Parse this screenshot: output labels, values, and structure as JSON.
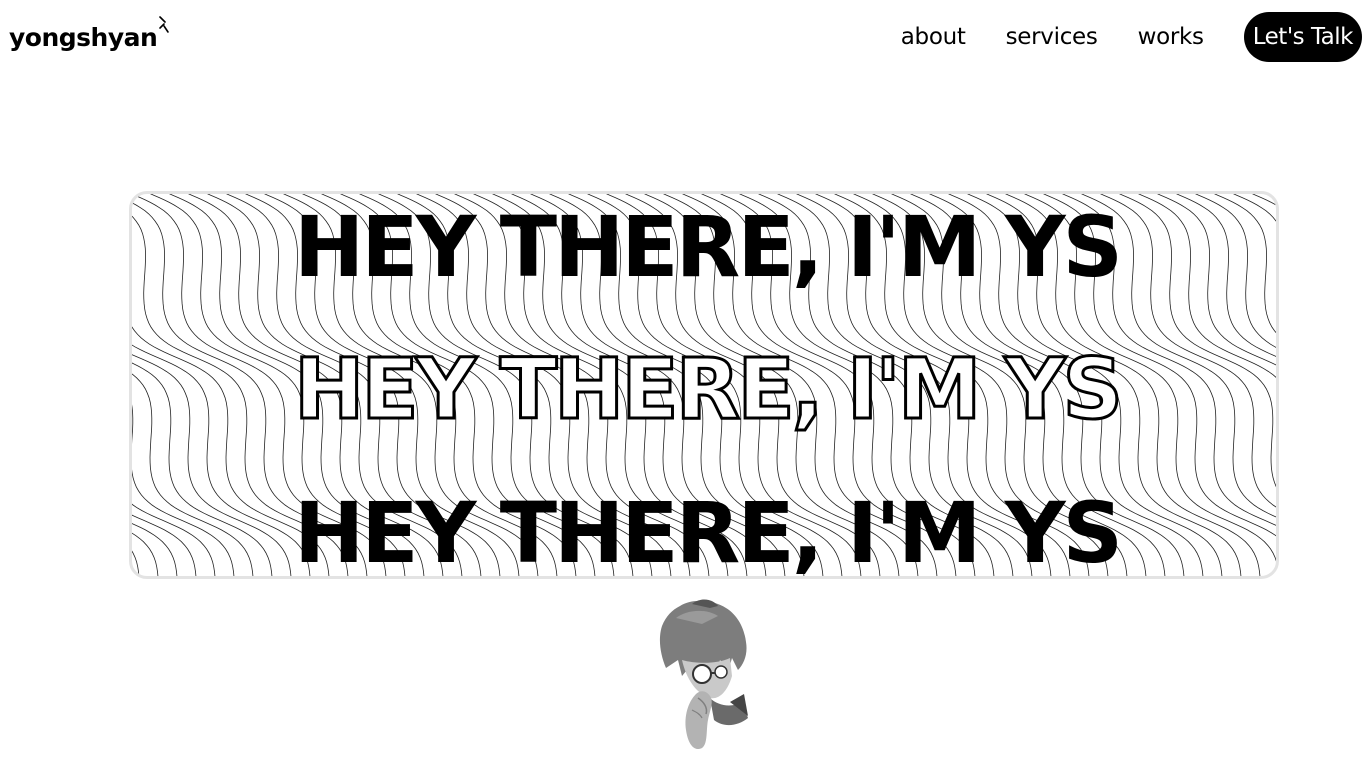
{
  "header": {
    "logo_text": "yongshyan",
    "logo_mark_icon": "sparkle-tick-icon"
  },
  "nav": {
    "links": [
      {
        "label": "about"
      },
      {
        "label": "services"
      },
      {
        "label": "works"
      }
    ],
    "cta_label": "Let's Talk"
  },
  "hero": {
    "lines": [
      "HEY THERE, I'M YS",
      "HEY THERE, I'M YS",
      "HEY THERE, I'M YS"
    ],
    "pattern_icon": "wavy-lines-pattern",
    "colors": {
      "border": "#e3e3e3",
      "text": "#000000"
    }
  },
  "avatar": {
    "icon": "character-portrait-illustration"
  }
}
